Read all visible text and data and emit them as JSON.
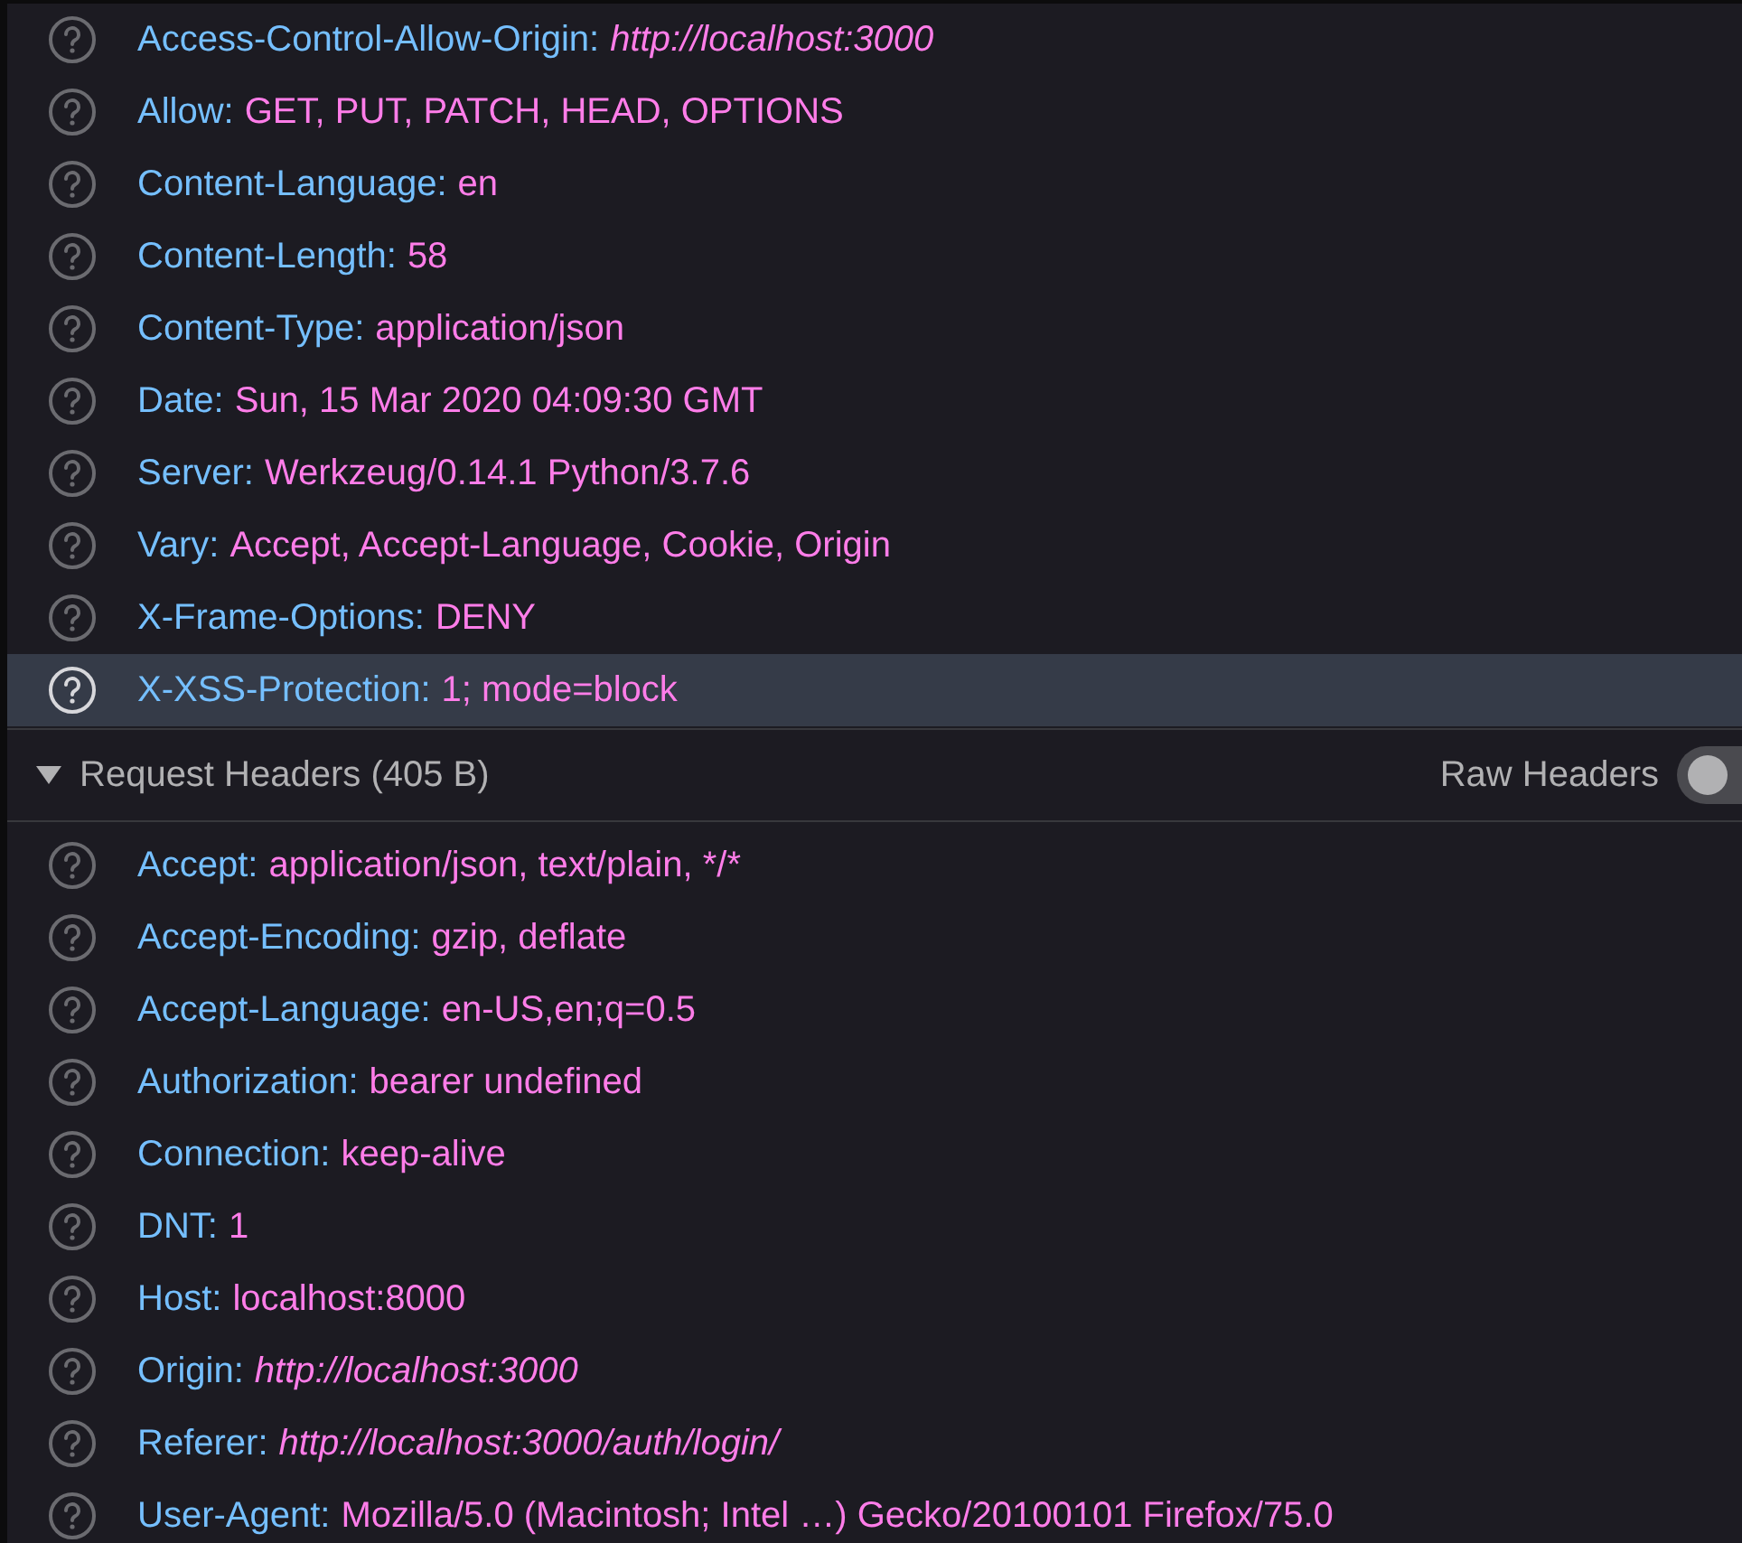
{
  "response_headers": [
    {
      "name": "Access-Control-Allow-Origin:",
      "value": "http://localhost:3000",
      "kind": "link",
      "selected": false
    },
    {
      "name": "Allow:",
      "value": "GET, PUT, PATCH, HEAD, OPTIONS",
      "kind": "plain",
      "selected": false
    },
    {
      "name": "Content-Language:",
      "value": "en",
      "kind": "plain",
      "selected": false
    },
    {
      "name": "Content-Length:",
      "value": "58",
      "kind": "plain",
      "selected": false
    },
    {
      "name": "Content-Type:",
      "value": "application/json",
      "kind": "plain",
      "selected": false
    },
    {
      "name": "Date:",
      "value": "Sun, 15 Mar 2020 04:09:30 GMT",
      "kind": "plain",
      "selected": false
    },
    {
      "name": "Server:",
      "value": "Werkzeug/0.14.1 Python/3.7.6",
      "kind": "plain",
      "selected": false
    },
    {
      "name": "Vary:",
      "value": "Accept, Accept-Language, Cookie, Origin",
      "kind": "plain",
      "selected": false
    },
    {
      "name": "X-Frame-Options:",
      "value": "DENY",
      "kind": "plain",
      "selected": false
    },
    {
      "name": "X-XSS-Protection:",
      "value": "1; mode=block",
      "kind": "plain",
      "selected": true
    }
  ],
  "request_section": {
    "title": "Request Headers (405 B)",
    "expanded": true,
    "raw_headers": {
      "label": "Raw Headers",
      "on": false
    }
  },
  "request_headers": [
    {
      "name": "Accept:",
      "value": "application/json, text/plain, */*",
      "kind": "plain",
      "selected": false
    },
    {
      "name": "Accept-Encoding:",
      "value": "gzip, deflate",
      "kind": "plain",
      "selected": false
    },
    {
      "name": "Accept-Language:",
      "value": "en-US,en;q=0.5",
      "kind": "plain",
      "selected": false
    },
    {
      "name": "Authorization:",
      "value": "bearer undefined",
      "kind": "plain",
      "selected": false
    },
    {
      "name": "Connection:",
      "value": "keep-alive",
      "kind": "plain",
      "selected": false
    },
    {
      "name": "DNT:",
      "value": "1",
      "kind": "plain",
      "selected": false
    },
    {
      "name": "Host:",
      "value": "localhost:8000",
      "kind": "plain",
      "selected": false
    },
    {
      "name": "Origin:",
      "value": "http://localhost:3000",
      "kind": "link",
      "selected": false
    },
    {
      "name": "Referer:",
      "value": "http://localhost:3000/auth/login/",
      "kind": "link",
      "selected": false
    },
    {
      "name": "User-Agent:",
      "value": "Mozilla/5.0 (Macintosh; Intel …) Gecko/20100101 Firefox/75.0",
      "kind": "plain",
      "selected": false
    }
  ]
}
